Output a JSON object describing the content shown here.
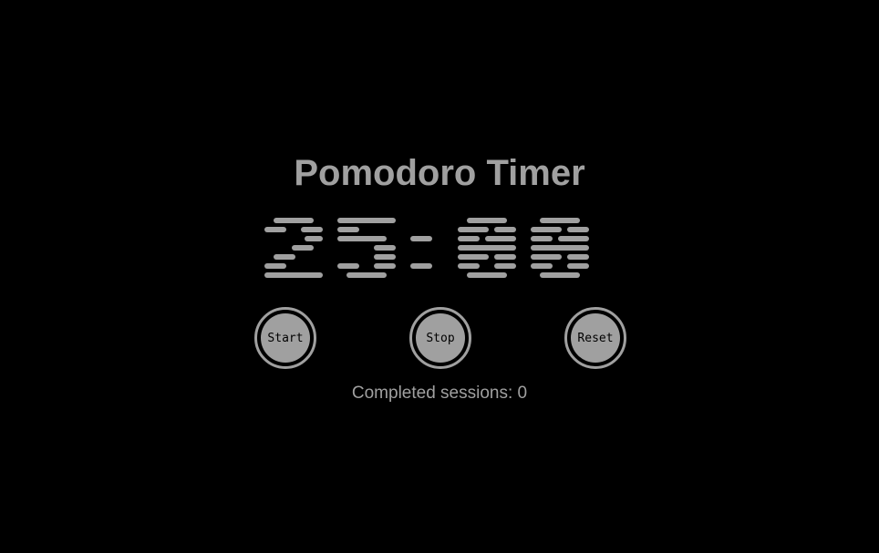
{
  "title": "Pomodoro Timer",
  "timer": {
    "display": "25:00",
    "minutes": "25",
    "seconds": "00"
  },
  "controls": {
    "start_label": "Start",
    "stop_label": "Stop",
    "reset_label": "Reset"
  },
  "sessions": {
    "text": "Completed sessions: 0",
    "label": "Completed sessions:",
    "count": 0
  },
  "colors": {
    "background": "#000000",
    "foreground": "#a0a0a0"
  }
}
